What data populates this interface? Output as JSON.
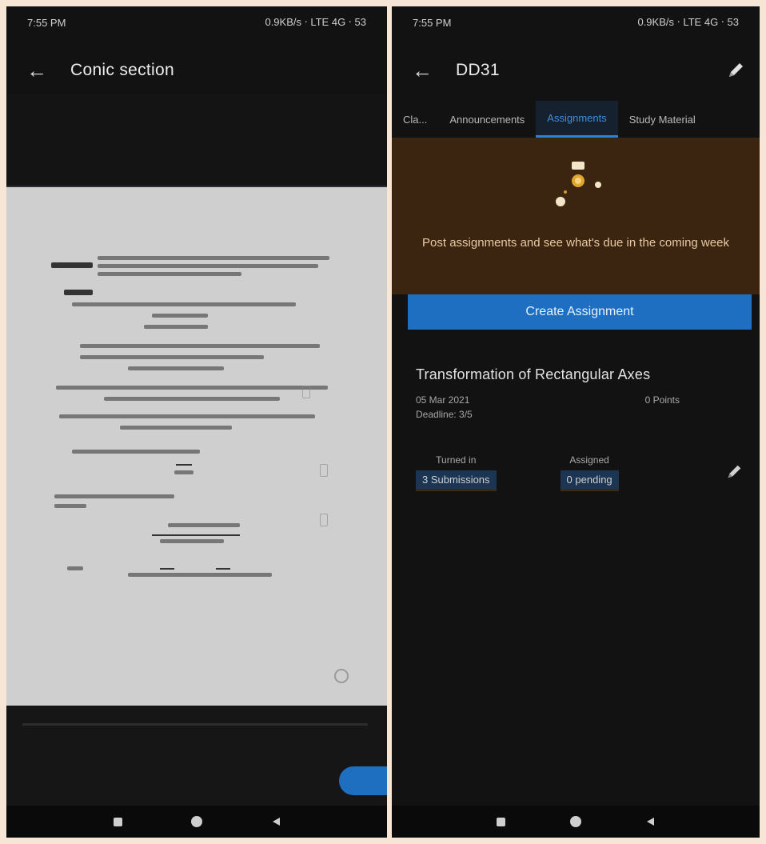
{
  "left_screen": {
    "status": {
      "time": "7:55 PM",
      "icons": "0.9KB/s ⋅ LTE 4G ⋅ 53"
    },
    "appbar": {
      "back": "←",
      "title": "Conic section"
    },
    "navbar": {
      "back": "◀",
      "home": "●",
      "recents": "■"
    }
  },
  "right_screen": {
    "status": {
      "time": "7:55 PM",
      "icons": "0.9KB/s ⋅ LTE 4G ⋅ 53"
    },
    "appbar": {
      "back": "←",
      "title": "DD31"
    },
    "tabs": [
      "Cla...",
      "Announcements",
      "Assignments",
      "Study Material"
    ],
    "active_tab_index": 2,
    "banner": {
      "text": "Post assignments and see what's due in the coming week"
    },
    "create_button": "Create Assignment",
    "assignment": {
      "title": "Transformation of Rectangular Axes",
      "posted": "05 Mar 2021",
      "points": "0 Points",
      "due": "Deadline: 3/5",
      "stats": [
        {
          "label": "Turned in",
          "value": "3 Submissions"
        },
        {
          "label": "Assigned",
          "value": "0 pending"
        }
      ]
    },
    "navbar": {
      "back": "◀",
      "home": "●",
      "recents": "■"
    }
  }
}
